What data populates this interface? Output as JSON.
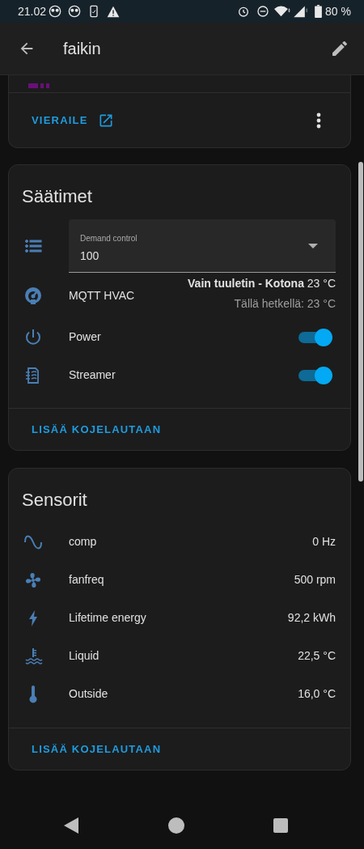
{
  "status_bar": {
    "time": "21.02",
    "battery": "80 %"
  },
  "app_bar": {
    "title": "faikin"
  },
  "device_card": {
    "visit_button": "VIERAILE"
  },
  "controls_card": {
    "title": "Säätimet",
    "select": {
      "label": "Demand control",
      "value": "100"
    },
    "climate": {
      "name": "MQTT HVAC",
      "state": "**Vain tuuletin - Kotona** 23 °C",
      "current": "Tällä hetkellä: 23 °C"
    },
    "switches": [
      {
        "name": "Power",
        "on": true
      },
      {
        "name": "Streamer",
        "on": true
      }
    ],
    "action": "LISÄÄ KOJELAUTAAN"
  },
  "sensors_card": {
    "title": "Sensorit",
    "rows": [
      {
        "name": "comp",
        "value": "0 Hz"
      },
      {
        "name": "fanfreq",
        "value": "500 rpm"
      },
      {
        "name": "Lifetime energy",
        "value": "92,2 kWh"
      },
      {
        "name": "Liquid",
        "value": "22,5 °C"
      },
      {
        "name": "Outside",
        "value": "16,0 °C"
      }
    ],
    "action": "LISÄÄ KOJELAUTAAN"
  }
}
